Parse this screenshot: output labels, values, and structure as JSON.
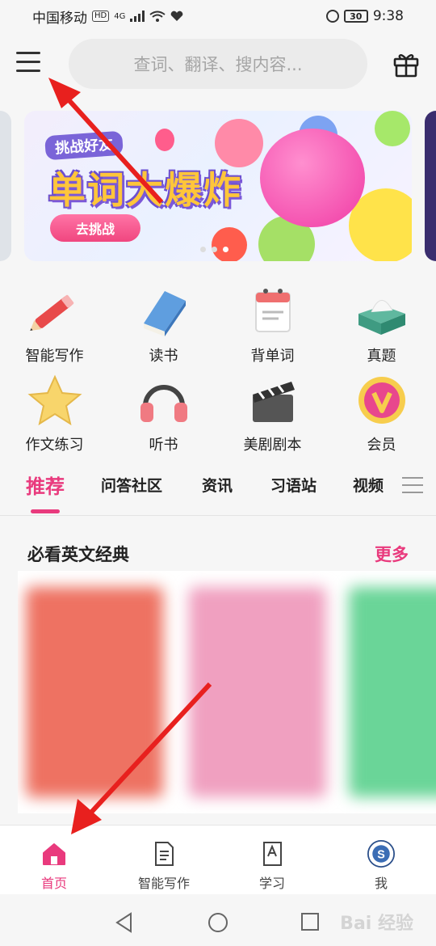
{
  "status": {
    "carrier": "中国移动",
    "hd": "HD",
    "net": "4G",
    "battery": "30",
    "time": "9:38"
  },
  "header": {
    "search_placeholder": "查词、翻译、搜内容..."
  },
  "banner": {
    "subtitle": "挑战好友",
    "title": "单词大爆炸",
    "button": "去挑战"
  },
  "grid": [
    {
      "label": "智能写作",
      "icon": "pencil-icon"
    },
    {
      "label": "读书",
      "icon": "book-icon"
    },
    {
      "label": "背单词",
      "icon": "calendar-icon"
    },
    {
      "label": "真题",
      "icon": "tissue-box-icon"
    },
    {
      "label": "作文练习",
      "icon": "star-icon"
    },
    {
      "label": "听书",
      "icon": "headphones-icon"
    },
    {
      "label": "美剧剧本",
      "icon": "clapperboard-icon"
    },
    {
      "label": "会员",
      "icon": "vip-badge-icon"
    }
  ],
  "tabs": [
    "推荐",
    "问答社区",
    "资讯",
    "习语站",
    "视频"
  ],
  "section": {
    "title": "必看英文经典",
    "more": "更多"
  },
  "bottom_nav": [
    {
      "label": "首页",
      "icon": "home-icon"
    },
    {
      "label": "智能写作",
      "icon": "document-icon"
    },
    {
      "label": "学习",
      "icon": "study-book-icon"
    },
    {
      "label": "我",
      "icon": "avatar-icon"
    }
  ],
  "colors": {
    "accent": "#e93a7d",
    "arrow": "#e8201e"
  },
  "watermark": "Bai 经验"
}
